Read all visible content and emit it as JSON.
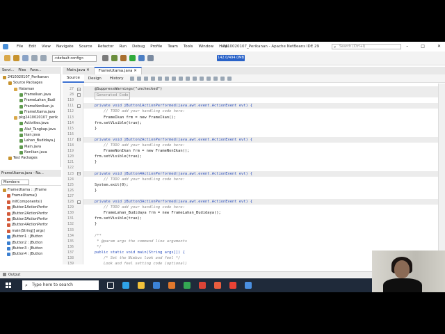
{
  "window": {
    "title": "24100201​07_Perikanan - Apache NetBeans IDE 29",
    "menu": [
      "File",
      "Edit",
      "View",
      "Navigate",
      "Source",
      "Refactor",
      "Run",
      "Debug",
      "Profile",
      "Team",
      "Tools",
      "Window",
      "Help"
    ],
    "search_placeholder": "Search (Ctrl+I)",
    "controls": [
      "–",
      "□",
      "✕"
    ]
  },
  "toolbar": {
    "config": "<default config>",
    "memory": "142.0/494.0MB"
  },
  "projects_panel": {
    "tabs": [
      "Servi...",
      "Files",
      "Favo..."
    ],
    "tree": [
      {
        "label": "2410020107_Perikanan",
        "indent": 0,
        "color": "#c7932f"
      },
      {
        "label": "Source Packages",
        "indent": 1,
        "color": "#c7932f"
      },
      {
        "label": "Halaman",
        "indent": 2,
        "color": "#d9a84a"
      },
      {
        "label": "FrameIkan.java",
        "indent": 3,
        "color": "#5f9b4f"
      },
      {
        "label": "FrameLahan_Budi",
        "indent": 3,
        "color": "#5f9b4f"
      },
      {
        "label": "FrameNonIkan.ja",
        "indent": 3,
        "color": "#5f9b4f"
      },
      {
        "label": "FrameUtama.java",
        "indent": 3,
        "color": "#5f9b4f"
      },
      {
        "label": "pkg2410020107_perik",
        "indent": 2,
        "color": "#d9a84a"
      },
      {
        "label": "Activities.java",
        "indent": 3,
        "color": "#5f9b4f"
      },
      {
        "label": "Alat_Tangkap.java",
        "indent": 3,
        "color": "#5f9b4f"
      },
      {
        "label": "Ikan.java",
        "indent": 3,
        "color": "#5f9b4f"
      },
      {
        "label": "Lahan_Budidaya.j",
        "indent": 3,
        "color": "#5f9b4f"
      },
      {
        "label": "Main.java",
        "indent": 3,
        "color": "#5f9b4f"
      },
      {
        "label": "NonIkan.java",
        "indent": 3,
        "color": "#5f9b4f"
      },
      {
        "label": "Test Packages",
        "indent": 1,
        "color": "#c7932f"
      }
    ]
  },
  "navigator": {
    "header": "FrameUtama.java - Na...",
    "filter_label": "Members",
    "items": [
      "FrameUtama :: JFrame",
      "FrameUtama()",
      "initComponents()",
      "jButton1ActionPerfor",
      "jButton2ActionPerfor",
      "jButton3ActionPerfor",
      "jButton4ActionPerfor",
      "main(String[] args)",
      "jButton1 : JButton",
      "jButton2 : JButton",
      "jButton3 : JButton",
      "jButton4 : JButton"
    ]
  },
  "editor": {
    "tabs": [
      "Main.java",
      "FrameUtama.java"
    ],
    "active_tab": 1,
    "subtabs": [
      "Source",
      "Design",
      "History"
    ],
    "lines": [
      {
        "no": "27",
        "text": "@SuppressWarnings(\"unchecked\")",
        "cls": "hl"
      },
      {
        "no": "28",
        "text": "Generated Code",
        "cls": "hl"
      },
      {
        "no": "110",
        "text": "",
        "cls": ""
      },
      {
        "no": "111",
        "text": "private void jButton1ActionPerformed(java.awt.event.ActionEvent evt) {",
        "cls": "hl"
      },
      {
        "no": "112",
        "text": "    // TODO add your handling code here:",
        "cls": "cm"
      },
      {
        "no": "113",
        "text": "    FrameIkan frm = new FrameIkan();",
        "cls": ""
      },
      {
        "no": "114",
        "text": "frm.setVisible(true);",
        "cls": ""
      },
      {
        "no": "115",
        "text": "}",
        "cls": ""
      },
      {
        "no": "116",
        "text": "",
        "cls": ""
      },
      {
        "no": "117",
        "text": "private void jButton2ActionPerformed(java.awt.event.ActionEvent evt) {",
        "cls": "hl"
      },
      {
        "no": "118",
        "text": "    // TODO add your handling code here:",
        "cls": "cm"
      },
      {
        "no": "119",
        "text": "    FrameNonIkan frm = new FrameNonIkan();",
        "cls": ""
      },
      {
        "no": "120",
        "text": "frm.setVisible(true);",
        "cls": ""
      },
      {
        "no": "121",
        "text": "}",
        "cls": ""
      },
      {
        "no": "122",
        "text": "",
        "cls": ""
      },
      {
        "no": "123",
        "text": "private void jButton4ActionPerformed(java.awt.event.ActionEvent evt) {",
        "cls": "hl"
      },
      {
        "no": "124",
        "text": "    // TODO add your handling code here:",
        "cls": "cm"
      },
      {
        "no": "125",
        "text": "System.exit(0);",
        "cls": ""
      },
      {
        "no": "126",
        "text": "}",
        "cls": ""
      },
      {
        "no": "127",
        "text": "",
        "cls": ""
      },
      {
        "no": "128",
        "text": "private void jButton3ActionPerformed(java.awt.event.ActionEvent evt) {",
        "cls": "hl"
      },
      {
        "no": "129",
        "text": "    // TODO add your handling code here:",
        "cls": "cm"
      },
      {
        "no": "130",
        "text": "    FrameLahan_Budidaya frm = new FrameLahan_Budidaya();",
        "cls": ""
      },
      {
        "no": "131",
        "text": "frm.setVisible(true);",
        "cls": ""
      },
      {
        "no": "132",
        "text": "}",
        "cls": ""
      },
      {
        "no": "133",
        "text": "",
        "cls": ""
      },
      {
        "no": "134",
        "text": "/**",
        "cls": "cm"
      },
      {
        "no": "135",
        "text": " * @param args the command line arguments",
        "cls": "cm"
      },
      {
        "no": "136",
        "text": " */",
        "cls": "cm"
      },
      {
        "no": "137",
        "text": "public static void main(String args[]) {",
        "cls": ""
      },
      {
        "no": "138",
        "text": "    /* Set the Nimbus look and feel */",
        "cls": "cm"
      },
      {
        "no": "139",
        "text": "    Look and feel setting code (optional)",
        "cls": "cm"
      }
    ]
  },
  "output": {
    "label": "Output"
  },
  "taskbar": {
    "search_placeholder": "Type here to search",
    "icons": [
      {
        "name": "task-view-icon",
        "color": "#ffffff"
      },
      {
        "name": "edge-icon",
        "color": "#2fa3e8"
      },
      {
        "name": "explorer-icon",
        "color": "#f2c13a"
      },
      {
        "name": "store-icon",
        "color": "#3b82d6"
      },
      {
        "name": "netbeans-icon",
        "color": "#e0782d"
      },
      {
        "name": "drive-icon",
        "color": "#34a853"
      },
      {
        "name": "chrome-icon",
        "color": "#db4437"
      },
      {
        "name": "app-icon",
        "color": "#e85d3f"
      },
      {
        "name": "chrome-alt-icon",
        "color": "#ea4335"
      },
      {
        "name": "netbeans-alt-icon",
        "color": "#4a8fe0"
      }
    ]
  }
}
